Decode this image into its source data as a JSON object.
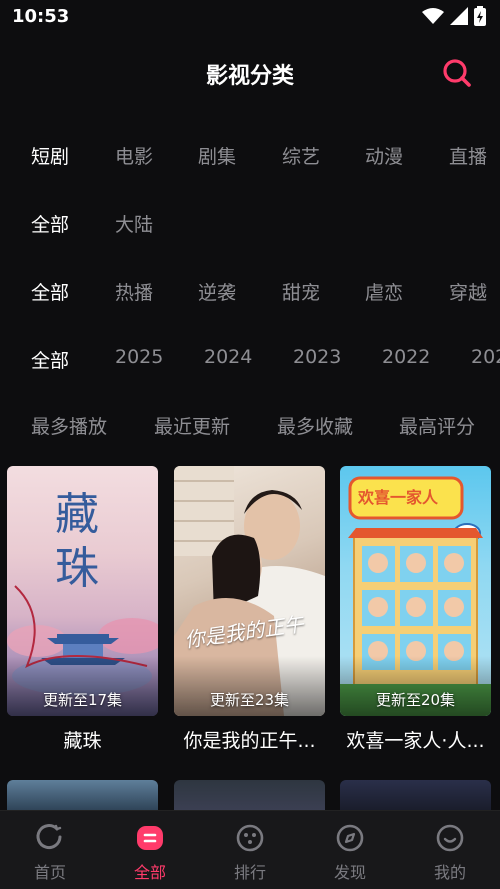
{
  "status_bar": {
    "time": "10:53"
  },
  "header": {
    "title": "影视分类"
  },
  "filters": {
    "category": [
      "短剧",
      "电影",
      "剧集",
      "综艺",
      "动漫",
      "直播"
    ],
    "region": [
      "全部",
      "大陆"
    ],
    "genre": [
      "全部",
      "热播",
      "逆袭",
      "甜宠",
      "虐恋",
      "穿越"
    ],
    "year": [
      "全部",
      "2025",
      "2024",
      "2023",
      "2022",
      "202"
    ]
  },
  "sort": [
    "最多播放",
    "最近更新",
    "最多收藏",
    "最高评分"
  ],
  "cards": [
    {
      "title": "藏珠",
      "update": "更新至17集",
      "poster_text": "藏珠"
    },
    {
      "title": "你是我的正午...",
      "update": "更新至23集",
      "poster_text": "你是我的正午暖阳"
    },
    {
      "title": "欢喜一家人·人...",
      "update": "更新至20集",
      "poster_text": "欢喜一家人 人生小事"
    }
  ],
  "tabs": [
    {
      "label": "首页",
      "icon": "home-icon"
    },
    {
      "label": "全部",
      "icon": "all-icon"
    },
    {
      "label": "排行",
      "icon": "ranking-icon"
    },
    {
      "label": "发现",
      "icon": "discover-icon"
    },
    {
      "label": "我的",
      "icon": "profile-icon"
    }
  ],
  "colors": {
    "accent": "#ff3b6b",
    "background": "#0d0d0f",
    "inactive": "#8e8e93"
  }
}
